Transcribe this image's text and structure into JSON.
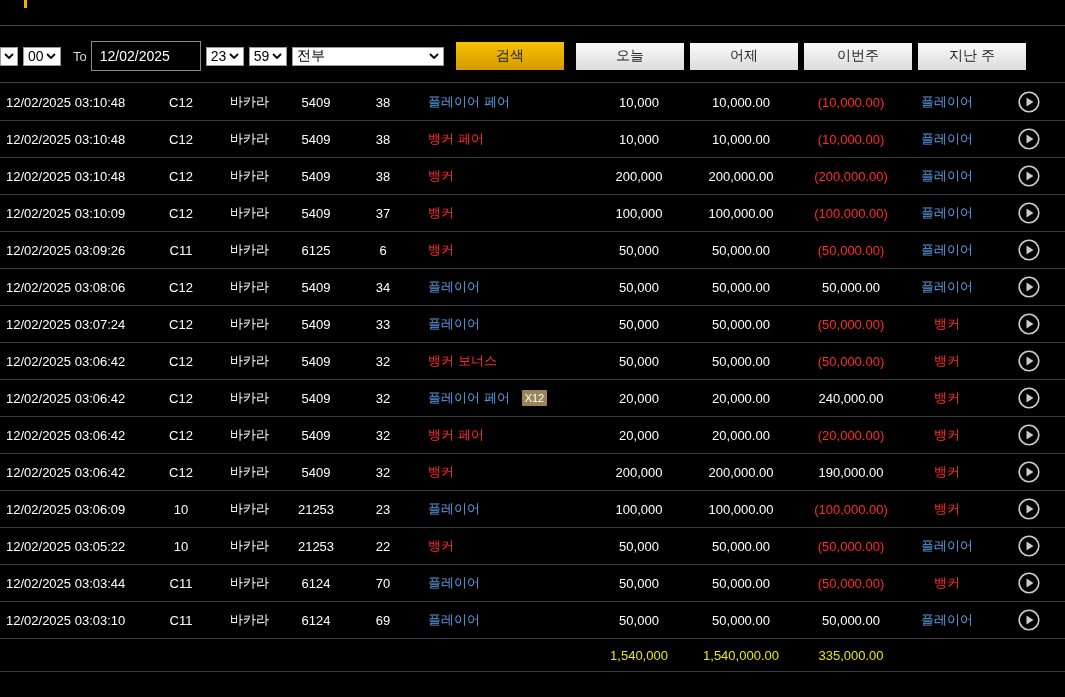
{
  "filter": {
    "from_minute": "00",
    "to_label": "To",
    "to_date": "12/02/2025",
    "to_hour": "23",
    "to_minute": "59",
    "bet_type": "전부",
    "search_button": "검색",
    "quick_ranges": [
      "오늘",
      "어제",
      "이번주",
      "지난 주"
    ]
  },
  "rows": [
    {
      "time": "12/02/2025 03:10:48",
      "table": "C12",
      "game": "바카라",
      "round": "5409",
      "hand": "38",
      "bet": {
        "label": "플레이어 페어",
        "kind": "player"
      },
      "amount": "10,000",
      "valid": "10,000.00",
      "win_loss": {
        "label": "(10,000.00)",
        "color": "#ff2a2a"
      },
      "result": {
        "label": "플레이어",
        "kind": "player"
      }
    },
    {
      "time": "12/02/2025 03:10:48",
      "table": "C12",
      "game": "바카라",
      "round": "5409",
      "hand": "38",
      "bet": {
        "label": "뱅커 페어",
        "kind": "banker"
      },
      "amount": "10,000",
      "valid": "10,000.00",
      "win_loss": {
        "label": "(10,000.00)",
        "color": "#ff2a2a"
      },
      "result": {
        "label": "플레이어",
        "kind": "player"
      }
    },
    {
      "time": "12/02/2025 03:10:48",
      "table": "C12",
      "game": "바카라",
      "round": "5409",
      "hand": "38",
      "bet": {
        "label": "뱅커",
        "kind": "banker"
      },
      "amount": "200,000",
      "valid": "200,000.00",
      "win_loss": {
        "label": "(200,000.00)",
        "color": "#ff2a2a"
      },
      "result": {
        "label": "플레이어",
        "kind": "player"
      }
    },
    {
      "time": "12/02/2025 03:10:09",
      "table": "C12",
      "game": "바카라",
      "round": "5409",
      "hand": "37",
      "bet": {
        "label": "뱅커",
        "kind": "banker"
      },
      "amount": "100,000",
      "valid": "100,000.00",
      "win_loss": {
        "label": "(100,000.00)",
        "color": "#ff2a2a"
      },
      "result": {
        "label": "플레이어",
        "kind": "player"
      }
    },
    {
      "time": "12/02/2025 03:09:26",
      "table": "C11",
      "game": "바카라",
      "round": "6125",
      "hand": "6",
      "bet": {
        "label": "뱅커",
        "kind": "banker"
      },
      "amount": "50,000",
      "valid": "50,000.00",
      "win_loss": {
        "label": "(50,000.00)",
        "color": "#ff2a2a"
      },
      "result": {
        "label": "플레이어",
        "kind": "player"
      }
    },
    {
      "time": "12/02/2025 03:08:06",
      "table": "C12",
      "game": "바카라",
      "round": "5409",
      "hand": "34",
      "bet": {
        "label": "플레이어",
        "kind": "player"
      },
      "amount": "50,000",
      "valid": "50,000.00",
      "win_loss": {
        "label": "50,000.00",
        "color": "#ffffff"
      },
      "result": {
        "label": "플레이어",
        "kind": "player"
      }
    },
    {
      "time": "12/02/2025 03:07:24",
      "table": "C12",
      "game": "바카라",
      "round": "5409",
      "hand": "33",
      "bet": {
        "label": "플레이어",
        "kind": "player"
      },
      "amount": "50,000",
      "valid": "50,000.00",
      "win_loss": {
        "label": "(50,000.00)",
        "color": "#ff2a2a"
      },
      "result": {
        "label": "뱅커",
        "kind": "banker"
      }
    },
    {
      "time": "12/02/2025 03:06:42",
      "table": "C12",
      "game": "바카라",
      "round": "5409",
      "hand": "32",
      "bet": {
        "label": "뱅커 보너스",
        "kind": "banker"
      },
      "amount": "50,000",
      "valid": "50,000.00",
      "win_loss": {
        "label": "(50,000.00)",
        "color": "#ff2a2a"
      },
      "result": {
        "label": "뱅커",
        "kind": "banker"
      }
    },
    {
      "time": "12/02/2025 03:06:42",
      "table": "C12",
      "game": "바카라",
      "round": "5409",
      "hand": "32",
      "bet": {
        "label": "플레이어 페어",
        "kind": "player"
      },
      "multiplier": "X12",
      "amount": "20,000",
      "valid": "20,000.00",
      "win_loss": {
        "label": "240,000.00",
        "color": "#ffffff"
      },
      "result": {
        "label": "뱅커",
        "kind": "banker"
      }
    },
    {
      "time": "12/02/2025 03:06:42",
      "table": "C12",
      "game": "바카라",
      "round": "5409",
      "hand": "32",
      "bet": {
        "label": "뱅커 페어",
        "kind": "banker"
      },
      "amount": "20,000",
      "valid": "20,000.00",
      "win_loss": {
        "label": "(20,000.00)",
        "color": "#ff2a2a"
      },
      "result": {
        "label": "뱅커",
        "kind": "banker"
      }
    },
    {
      "time": "12/02/2025 03:06:42",
      "table": "C12",
      "game": "바카라",
      "round": "5409",
      "hand": "32",
      "bet": {
        "label": "뱅커",
        "kind": "banker"
      },
      "amount": "200,000",
      "valid": "200,000.00",
      "win_loss": {
        "label": "190,000.00",
        "color": "#ffffff"
      },
      "result": {
        "label": "뱅커",
        "kind": "banker"
      }
    },
    {
      "time": "12/02/2025 03:06:09",
      "table": "10",
      "game": "바카라",
      "round": "21253",
      "hand": "23",
      "bet": {
        "label": "플레이어",
        "kind": "player"
      },
      "amount": "100,000",
      "valid": "100,000.00",
      "win_loss": {
        "label": "(100,000.00)",
        "color": "#ff2a2a"
      },
      "result": {
        "label": "뱅커",
        "kind": "banker"
      }
    },
    {
      "time": "12/02/2025 03:05:22",
      "table": "10",
      "game": "바카라",
      "round": "21253",
      "hand": "22",
      "bet": {
        "label": "뱅커",
        "kind": "banker"
      },
      "amount": "50,000",
      "valid": "50,000.00",
      "win_loss": {
        "label": "(50,000.00)",
        "color": "#ff2a2a"
      },
      "result": {
        "label": "플레이어",
        "kind": "player"
      }
    },
    {
      "time": "12/02/2025 03:03:44",
      "table": "C11",
      "game": "바카라",
      "round": "6124",
      "hand": "70",
      "bet": {
        "label": "플레이어",
        "kind": "player"
      },
      "amount": "50,000",
      "valid": "50,000.00",
      "win_loss": {
        "label": "(50,000.00)",
        "color": "#ff2a2a"
      },
      "result": {
        "label": "뱅커",
        "kind": "banker"
      }
    },
    {
      "time": "12/02/2025 03:03:10",
      "table": "C11",
      "game": "바카라",
      "round": "6124",
      "hand": "69",
      "bet": {
        "label": "플레이어",
        "kind": "player"
      },
      "amount": "50,000",
      "valid": "50,000.00",
      "win_loss": {
        "label": "50,000.00",
        "color": "#ffffff"
      },
      "result": {
        "label": "플레이어",
        "kind": "player"
      }
    }
  ],
  "totals": {
    "amount": "1,540,000",
    "valid": "1,540,000.00",
    "win_loss": "335,000.00"
  }
}
